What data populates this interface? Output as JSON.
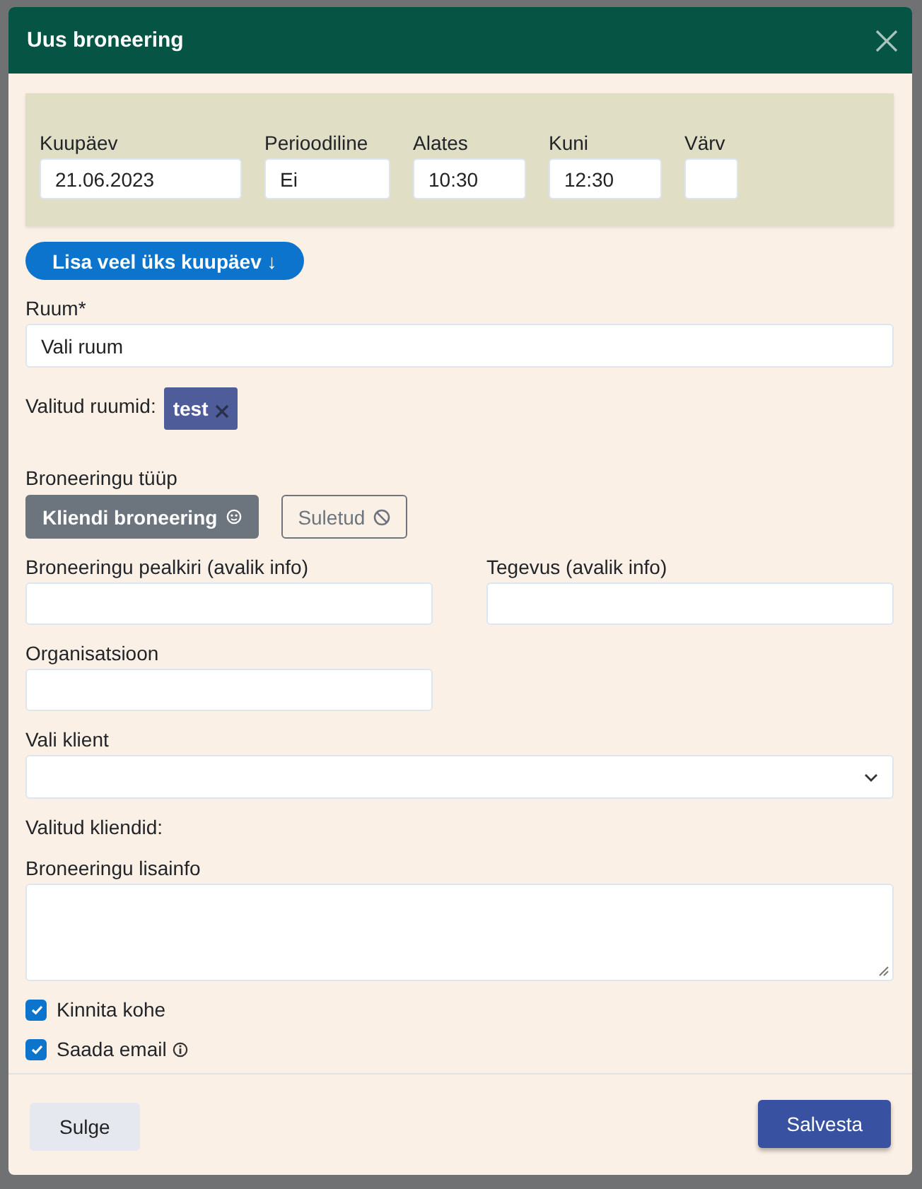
{
  "dialog": {
    "title": "Uus broneering"
  },
  "date_row": [
    {
      "kind": "date",
      "label": "Kuupäev",
      "value": "21.06.2023"
    },
    {
      "kind": "select",
      "label": "Perioodiline",
      "value": "Ei"
    },
    {
      "kind": "time",
      "label": "Alates",
      "value": "10:30"
    },
    {
      "kind": "time",
      "label": "Kuni",
      "value": "12:30"
    },
    {
      "kind": "color",
      "label": "Värv"
    }
  ],
  "add_date_button": "Lisa veel üks kuupäev ↓",
  "room": {
    "label": "Ruum*",
    "value": "Vali ruum"
  },
  "selected_rooms": {
    "label": "Valitud ruumid:",
    "tags": [
      "test"
    ]
  },
  "booking_type": {
    "label": "Broneeringu tüüp",
    "options": [
      {
        "kind": "client",
        "label": "Kliendi broneering",
        "selected": true
      },
      {
        "kind": "closed",
        "label": "Suletud",
        "selected": false
      }
    ]
  },
  "title_field": {
    "label": "Broneeringu pealkiri (avalik info)"
  },
  "activity_field": {
    "label": "Tegevus (avalik info)"
  },
  "organisation_field": {
    "label": "Organisatsioon"
  },
  "client_select": {
    "label": "Vali klient"
  },
  "selected_clients": {
    "label": "Valitud kliendid:"
  },
  "notes": {
    "label": "Broneeringu lisainfo"
  },
  "checkboxes": [
    {
      "label": "Kinnita kohe",
      "checked": true,
      "info": false
    },
    {
      "label": "Saada email",
      "checked": true,
      "info": true
    }
  ],
  "footer": {
    "close": "Sulge",
    "save": "Salvesta"
  }
}
